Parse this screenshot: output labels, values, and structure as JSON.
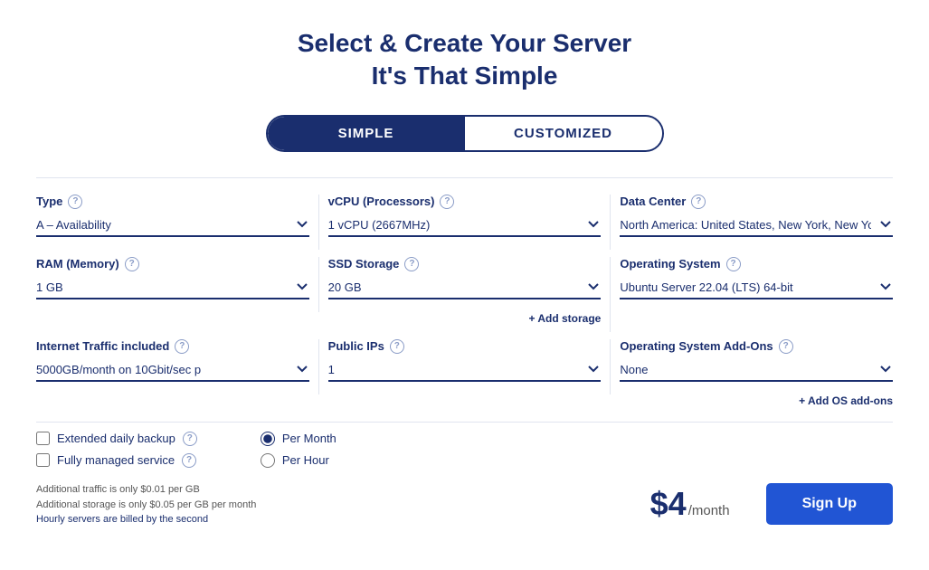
{
  "page": {
    "title_line1": "Select & Create Your Server",
    "title_line2": "It's That Simple"
  },
  "toggle": {
    "simple_label": "SIMPLE",
    "customized_label": "CUSTOMIZED"
  },
  "fields": {
    "type": {
      "label": "Type",
      "value": "A – Availability"
    },
    "vcpu": {
      "label": "vCPU (Processors)",
      "value": "1 vCPU (2667MHz)"
    },
    "datacenter": {
      "label": "Data Center",
      "value": "North America: United States, New York, New York"
    },
    "ram": {
      "label": "RAM (Memory)",
      "value": "1 GB"
    },
    "ssd": {
      "label": "SSD Storage",
      "value": "20 GB"
    },
    "os": {
      "label": "Operating System",
      "value": "Ubuntu Server 22.04 (LTS) 64-bit"
    },
    "internet": {
      "label": "Internet Traffic included",
      "value": "5000GB/month on 10Gbit/sec p"
    },
    "public_ips": {
      "label": "Public IPs",
      "value": "1"
    },
    "os_addons": {
      "label": "Operating System Add-Ons",
      "value": "None"
    }
  },
  "links": {
    "add_storage": "+ Add storage",
    "add_os_addons": "+ Add OS add-ons"
  },
  "options": {
    "extended_backup": "Extended daily backup",
    "fully_managed": "Fully managed service",
    "per_month": "Per Month",
    "per_hour": "Per Hour"
  },
  "notes": {
    "line1": "Additional traffic is only $0.01 per GB",
    "line2": "Additional storage is only $0.05 per GB per month",
    "line3": "Hourly servers are billed by the second"
  },
  "pricing": {
    "amount": "$4",
    "unit": "/month"
  },
  "actions": {
    "signup": "Sign Up"
  }
}
